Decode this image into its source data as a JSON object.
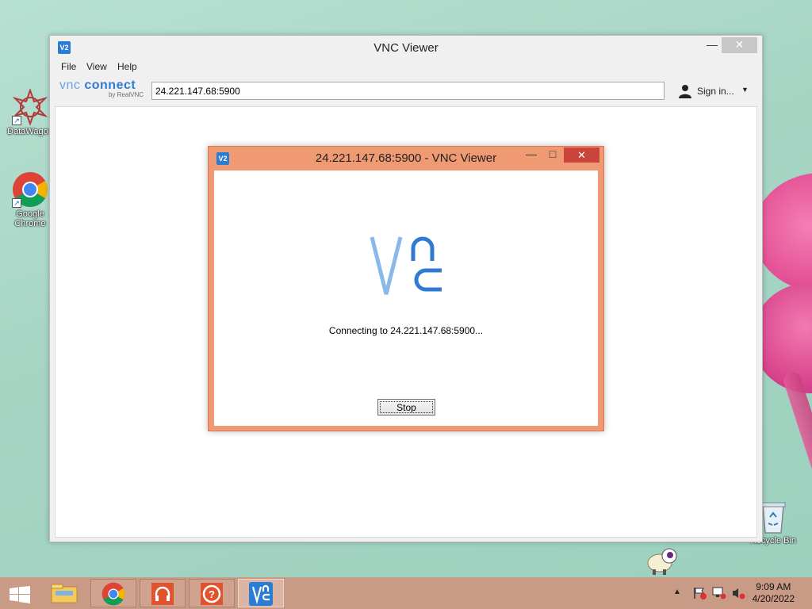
{
  "desktop": {
    "icons": [
      {
        "label": "DataWagon",
        "icon": "datawagon-icon"
      },
      {
        "label": "Google Chrome",
        "icon": "chrome-icon"
      },
      {
        "label": "Recycle Bin",
        "icon": "recycle-bin-icon"
      }
    ]
  },
  "main_window": {
    "app_icon": "V2",
    "title": "VNC Viewer",
    "menu": [
      "File",
      "View",
      "Help"
    ],
    "logo": {
      "line1_a": "vnc",
      "line1_b": "connect",
      "line2": "by RealVNC"
    },
    "address_value": "24.221.147.68:5900",
    "sign_in_label": "Sign in..."
  },
  "dialog": {
    "app_icon": "V2",
    "title": "24.221.147.68:5900 - VNC Viewer",
    "connecting_text": "Connecting to 24.221.147.68:5900...",
    "stop_label": "Stop"
  },
  "taskbar": {
    "apps": [
      "start-icon",
      "file-explorer-icon",
      "chrome-icon",
      "headphones-app-icon",
      "help-app-icon",
      "vnc-viewer-icon"
    ],
    "clock": {
      "time": "9:09 AM",
      "date": "4/20/2022"
    }
  },
  "colors": {
    "dialog_frame": "#ef9a73",
    "dialog_close": "#c9443a",
    "taskbar": "#c99a86",
    "vnc_blue": "#2f7bd2"
  }
}
